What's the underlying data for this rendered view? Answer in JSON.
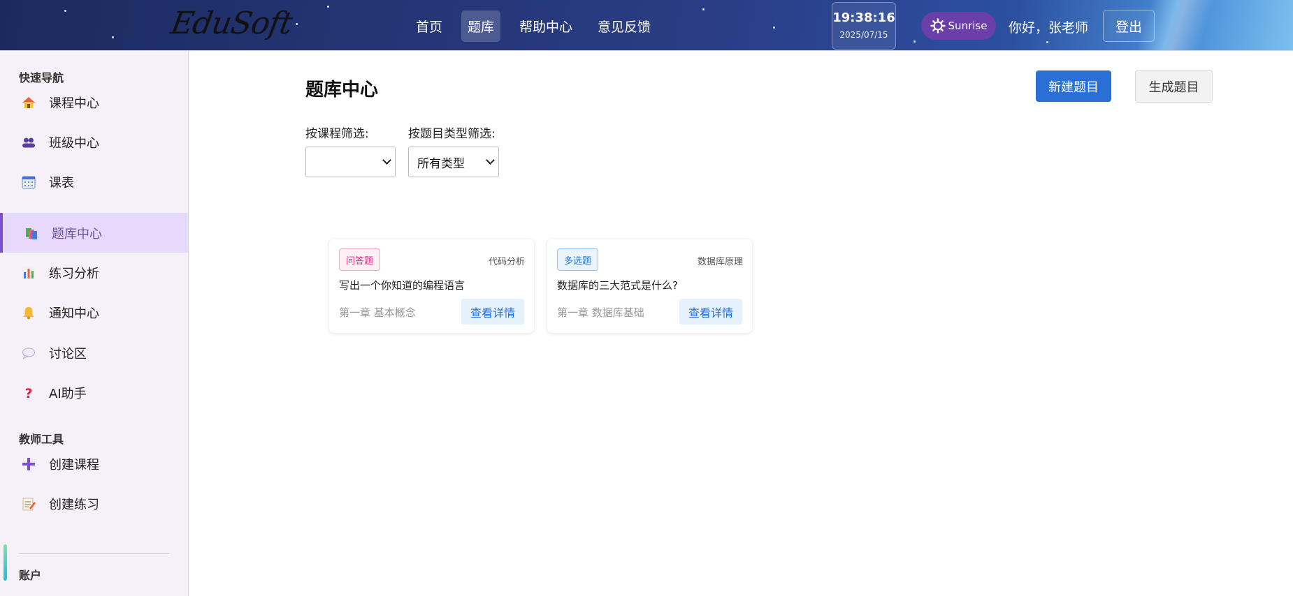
{
  "header": {
    "logo": "EduSoft",
    "nav": [
      "首页",
      "题库",
      "帮助中心",
      "意见反馈"
    ],
    "active_nav": "题库",
    "clock_time": "19:38:16",
    "clock_date": "2025/07/15",
    "theme_label": "Sunrise",
    "theme_icon": "sun-gear-icon",
    "greeting": "你好，张老师",
    "logout_label": "登出"
  },
  "sidebar": {
    "quick_nav_title": "快速导航",
    "items": [
      {
        "label": "课程中心",
        "icon": "house-icon"
      },
      {
        "label": "班级中心",
        "icon": "users-icon"
      },
      {
        "label": "课表",
        "icon": "calendar-icon"
      },
      {
        "label": "题库中心",
        "icon": "books-icon",
        "active": true
      },
      {
        "label": "练习分析",
        "icon": "bar-chart-icon"
      },
      {
        "label": "通知中心",
        "icon": "bell-icon"
      },
      {
        "label": "讨论区",
        "icon": "speech-bubble-icon"
      },
      {
        "label": "AI助手",
        "icon": "question-icon"
      }
    ],
    "teacher_tools_title": "教师工具",
    "tools": [
      {
        "label": "创建课程",
        "icon": "plus-icon"
      },
      {
        "label": "创建练习",
        "icon": "memo-icon"
      }
    ],
    "account_title": "账户"
  },
  "main": {
    "title": "题库中心",
    "new_button": "新建题目",
    "generate_button": "生成题目",
    "filter_course_label": "按课程筛选:",
    "filter_course_value": "",
    "filter_type_label": "按题目类型筛选:",
    "filter_type_value": "所有类型",
    "cards": [
      {
        "type": "问答题",
        "course": "代码分析",
        "question": "写出一个你知道的编程语言",
        "chapter": "第一章 基本概念",
        "action": "查看详情"
      },
      {
        "type": "多选题",
        "course": "数据库原理",
        "question": "数据库的三大范式是什么?",
        "chapter": "第一章 数据库基础",
        "action": "查看详情"
      }
    ]
  },
  "colors": {
    "accent": "#2a6fd6",
    "sidebar_active_bg": "#e7d9fb",
    "theme_button": "#6b3fa8"
  }
}
